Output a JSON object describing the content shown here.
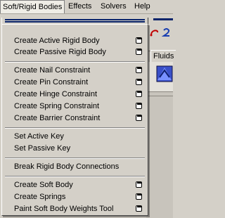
{
  "menubar": {
    "items": [
      {
        "label": "Soft/Rigid Bodies"
      },
      {
        "label": "Effects"
      },
      {
        "label": "Solvers"
      },
      {
        "label": "Help"
      }
    ]
  },
  "background": {
    "fluids_tab": "Fluids"
  },
  "menu": {
    "items": [
      {
        "label": "Create Active Rigid Body",
        "has_options": true
      },
      {
        "label": "Create Passive Rigid Body",
        "has_options": true
      },
      {
        "label": "Create Nail Constraint",
        "has_options": true
      },
      {
        "label": "Create Pin Constraint",
        "has_options": true
      },
      {
        "label": "Create Hinge Constraint",
        "has_options": true
      },
      {
        "label": "Create Spring Constraint",
        "has_options": true
      },
      {
        "label": "Create Barrier Constraint",
        "has_options": true
      },
      {
        "label": "Set Active Key",
        "has_options": false
      },
      {
        "label": "Set Passive Key",
        "has_options": false
      },
      {
        "label": "Break Rigid Body Connections",
        "has_options": false
      },
      {
        "label": "Create Soft Body",
        "has_options": true
      },
      {
        "label": "Create Springs",
        "has_options": true
      },
      {
        "label": "Paint Soft Body Weights Tool",
        "has_options": true
      }
    ]
  },
  "colors": {
    "menu_bg": "#d4d0c8",
    "tearoff": "#0a246a"
  },
  "icons": {
    "option_box": "option-box-icon"
  }
}
